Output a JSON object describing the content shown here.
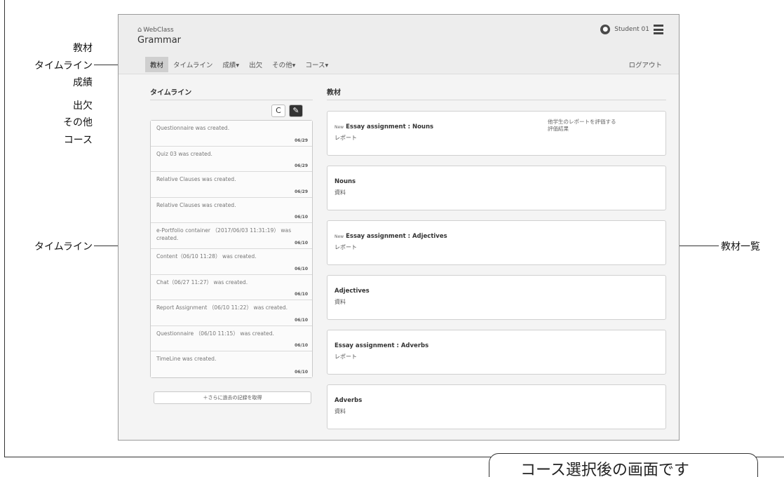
{
  "annotations": {
    "left": [
      "教材",
      "タイムライン",
      "成績",
      "出欠",
      "その他",
      "コース"
    ],
    "timeline_label": "タイムライン",
    "materials_label": "教材一覧"
  },
  "app": {
    "brand": "WebClass",
    "course_title": "Grammar",
    "user_name": "Student 01",
    "nav": [
      "教材",
      "タイムライン",
      "成績▾",
      "出欠",
      "その他▾",
      "コース▾"
    ],
    "logout": "ログアウト"
  },
  "timeline": {
    "heading": "タイムライン",
    "refresh_icon": "C",
    "edit_icon": "✎",
    "items": [
      {
        "text": "Questionnaire was created.",
        "date": "06/29"
      },
      {
        "text": "Quiz 03 was created.",
        "date": "06/29"
      },
      {
        "text": "Relative Clauses was created.",
        "date": "06/29"
      },
      {
        "text": "Relative Clauses was created.",
        "date": "06/10"
      },
      {
        "text": "e-Portfolio container （2017/06/03 11:31:19） was created.",
        "date": "06/10"
      },
      {
        "text": "Content（06/10 11:28） was created.",
        "date": "06/10"
      },
      {
        "text": "Chat（06/27 11:27） was created.",
        "date": "06/10"
      },
      {
        "text": "Report Assignment （06/10 11:22） was created.",
        "date": "06/10"
      },
      {
        "text": "Questionnaire （06/10 11:15） was created.",
        "date": "06/10"
      },
      {
        "text": "TimeLine was created.",
        "date": "06/10"
      }
    ],
    "more": "＋さらに過去の記録を取得"
  },
  "materials": {
    "heading": "教材",
    "items": [
      {
        "new": "New",
        "title": "Essay assignment : Nouns",
        "type": "レポート",
        "side": "他学生のレポートを評価する\n評価結果"
      },
      {
        "new": "",
        "title": "Nouns",
        "type": "資料",
        "side": ""
      },
      {
        "new": "New",
        "title": "Essay assignment : Adjectives",
        "type": "レポート",
        "side": ""
      },
      {
        "new": "",
        "title": "Adjectives",
        "type": "資料",
        "side": ""
      },
      {
        "new": "",
        "title": "Essay assignment : Adverbs",
        "type": "レポート",
        "side": ""
      },
      {
        "new": "",
        "title": "Adverbs",
        "type": "資料",
        "side": ""
      }
    ]
  },
  "caption": "コース選択後の画面です"
}
